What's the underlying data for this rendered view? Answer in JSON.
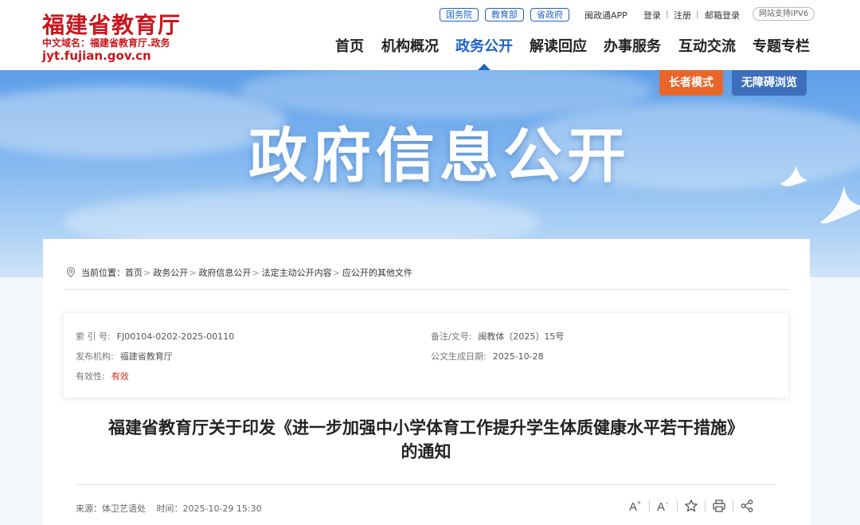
{
  "header": {
    "site_title": "福建省教育厅",
    "domain_line": "中文域名：福建省教育厅.政务",
    "url": "jyt.fujian.gov.cn",
    "gov_links": [
      "国务院",
      "教育部",
      "省政府"
    ],
    "app_link": "闽政通APP",
    "login": "登录",
    "register": "注册",
    "mail_login": "邮箱登录",
    "ipv6": "网站支持IPV6"
  },
  "nav": {
    "items": [
      "首页",
      "机构概况",
      "政务公开",
      "解读回应",
      "办事服务",
      "互动交流",
      "专题专栏"
    ],
    "active_index": 2
  },
  "banner": {
    "title": "政府信息公开",
    "elder_mode": "长者模式",
    "accessible": "无障碍浏览"
  },
  "breadcrumb": {
    "prefix": "当前位置：",
    "items": [
      "首页",
      "政务公开",
      "政府信息公开",
      "法定主动公开内容",
      "应公开的其他文件"
    ],
    "separator": ">"
  },
  "meta": {
    "index_label": "索 引 号:",
    "index_value": "FJ00104-0202-2025-00110",
    "doc_no_label": "备注/文号:",
    "doc_no_value": "闽教体〔2025〕15号",
    "publisher_label": "发布机构:",
    "publisher_value": "福建省教育厅",
    "date_label": "公文生成日期:",
    "date_value": "2025-10-28",
    "validity_label": "有效性:",
    "validity_value": "有效"
  },
  "article": {
    "title_line1": "福建省教育厅关于印发《进一步加强中小学体育工作提升学生体质健康水平若干措施》",
    "title_line2": "的通知",
    "source": "来源：体卫艺语处",
    "time": "时间：2025-10-29 15:30"
  },
  "colors": {
    "brand_red": "#c8161d",
    "accent_blue": "#1d63c2",
    "elder_orange": "#e8662a",
    "access_blue": "#3e6fbd"
  }
}
